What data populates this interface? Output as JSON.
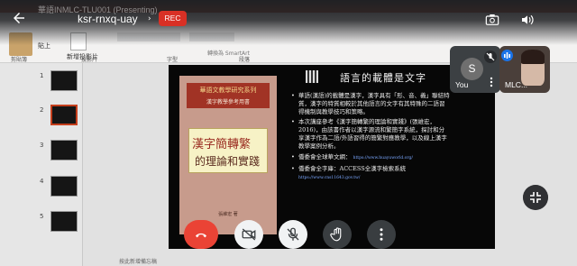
{
  "meeting": {
    "code": "ksr-rnxq-uay",
    "rec_label": "REC",
    "window_title_blurred": "華語INMLC-TLU001 (Presenting)"
  },
  "participants": [
    {
      "initial": "S",
      "name": "You"
    },
    {
      "name": "MLC..."
    }
  ],
  "ppt": {
    "paste_label": "貼上",
    "new_slide_label": "新增投影片",
    "ribbon_groups": [
      "剪貼簿",
      "投影片",
      "字型",
      "段落"
    ],
    "drawing_label": "轉換為 SmartArt",
    "thumbnail_numbers": [
      "1",
      "2",
      "3",
      "4",
      "5"
    ],
    "status_notes": "按此新增備忘稿"
  },
  "slide": {
    "title": "語言的載體是文字",
    "book_title": "華語文教學研究系列",
    "book_subtitle": "漢字教學參考用書",
    "book_cal_line1": "漢字簡轉繁",
    "book_cal_line2": "的理論和實踐",
    "book_author": "張維宏 著",
    "bullets": [
      "華語(漢語)的載體是漢字，漢字具有「形、音、義」聯結特質，漢字的特質相較於其他語言的文字有其特殊的二語習得機制與教學技巧和策略。",
      "本次講座參考《漢字簡轉繁的理論和實踐》(張維宏，2016)，由該書作者以漢字源流和繁簡字系統，探討和分享漢字作為二語/外語習得的簡繁對應教學，以及線上漢字教學案例分析。",
      "僑委會全球華文網：",
      "僑委會全字庫：ACCESS全漢字檢索系統"
    ],
    "link1": "https://www.huayuworld.org/",
    "link2": "https://www.cns11643.gov.tw/"
  },
  "colors": {
    "rec": "#d93025",
    "end_call": "#ea4335",
    "ppt_accent": "#b7472a"
  },
  "icons": [
    "back-arrow-icon",
    "camera-flip-icon",
    "speaker-icon",
    "mic-off-icon",
    "more-vert-icon",
    "exit-fullscreen-icon",
    "end-call-icon",
    "camera-off-icon",
    "raise-hand-icon"
  ]
}
